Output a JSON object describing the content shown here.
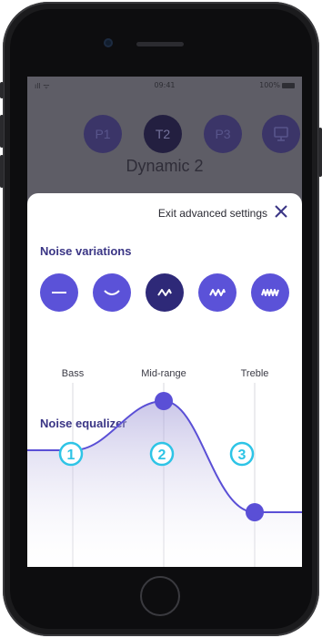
{
  "status_bar": {
    "signal": "ıll ᯤ",
    "time": "09:41",
    "battery": "100%"
  },
  "presets": [
    {
      "label": "P1",
      "active": false
    },
    {
      "label": "T2",
      "active": true
    },
    {
      "label": "P3",
      "active": false
    },
    {
      "label": "",
      "icon": "monitor-icon",
      "active": false
    }
  ],
  "profile_name": "Dynamic 2",
  "sheet": {
    "exit_label": "Exit advanced settings",
    "close_icon": "close-icon",
    "noise_variations_title": "Noise variations",
    "variations": [
      {
        "icon": "flat-line-icon",
        "selected": false
      },
      {
        "icon": "gentle-curve-icon",
        "selected": false
      },
      {
        "icon": "wave-icon",
        "selected": true
      },
      {
        "icon": "multi-wave-icon",
        "selected": false
      },
      {
        "icon": "dense-wave-icon",
        "selected": false
      }
    ],
    "noise_equalizer_title": "Noise equalizer",
    "bands": [
      {
        "label": "Bass",
        "marker": "1"
      },
      {
        "label": "Mid-range",
        "marker": "2"
      },
      {
        "label": "Treble",
        "marker": "3"
      }
    ]
  },
  "colors": {
    "accent": "#5b52d8",
    "selected": "#2e2978",
    "title": "#3a3585",
    "marker": "#2ec4e6",
    "handle": "#5a4fd6"
  }
}
